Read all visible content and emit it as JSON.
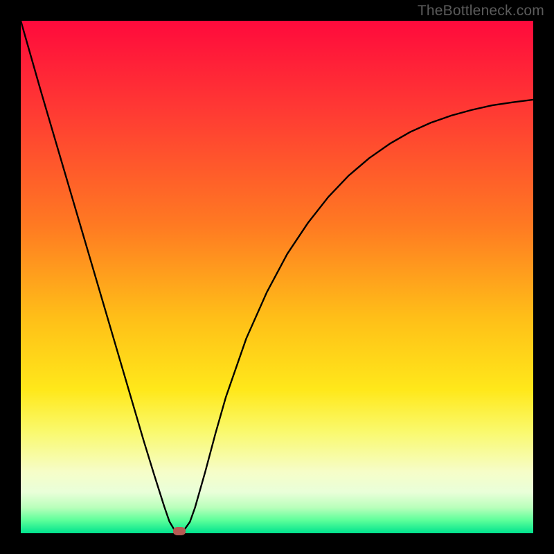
{
  "watermark": "TheBottleneck.com",
  "chart_data": {
    "type": "line",
    "title": "",
    "xlabel": "",
    "ylabel": "",
    "xlim": [
      0,
      100
    ],
    "ylim": [
      0,
      100
    ],
    "grid": false,
    "series": [
      {
        "name": "bottleneck-curve",
        "x": [
          0,
          2,
          4,
          6,
          8,
          10,
          12,
          14,
          16,
          18,
          20,
          22,
          24,
          26,
          28,
          29,
          30,
          31,
          32,
          33,
          34,
          36,
          38,
          40,
          44,
          48,
          52,
          56,
          60,
          64,
          68,
          72,
          76,
          80,
          84,
          88,
          92,
          96,
          100
        ],
        "y": [
          100,
          93,
          86,
          79.2,
          72.4,
          65.6,
          58.8,
          52,
          45.2,
          38.4,
          31.6,
          24.8,
          18,
          11.5,
          5.2,
          2.3,
          0.6,
          0.4,
          0.8,
          2.2,
          5,
          12,
          19.5,
          26.5,
          38,
          47,
          54.5,
          60.5,
          65.6,
          69.8,
          73.2,
          76,
          78.3,
          80.1,
          81.5,
          82.6,
          83.5,
          84.1,
          84.6
        ]
      }
    ],
    "marker": {
      "x": 31,
      "y": 0.4
    },
    "background_gradient": {
      "top": "#ff0a3c",
      "mid": "#ffe81a",
      "bottom": "#00e38e"
    }
  }
}
